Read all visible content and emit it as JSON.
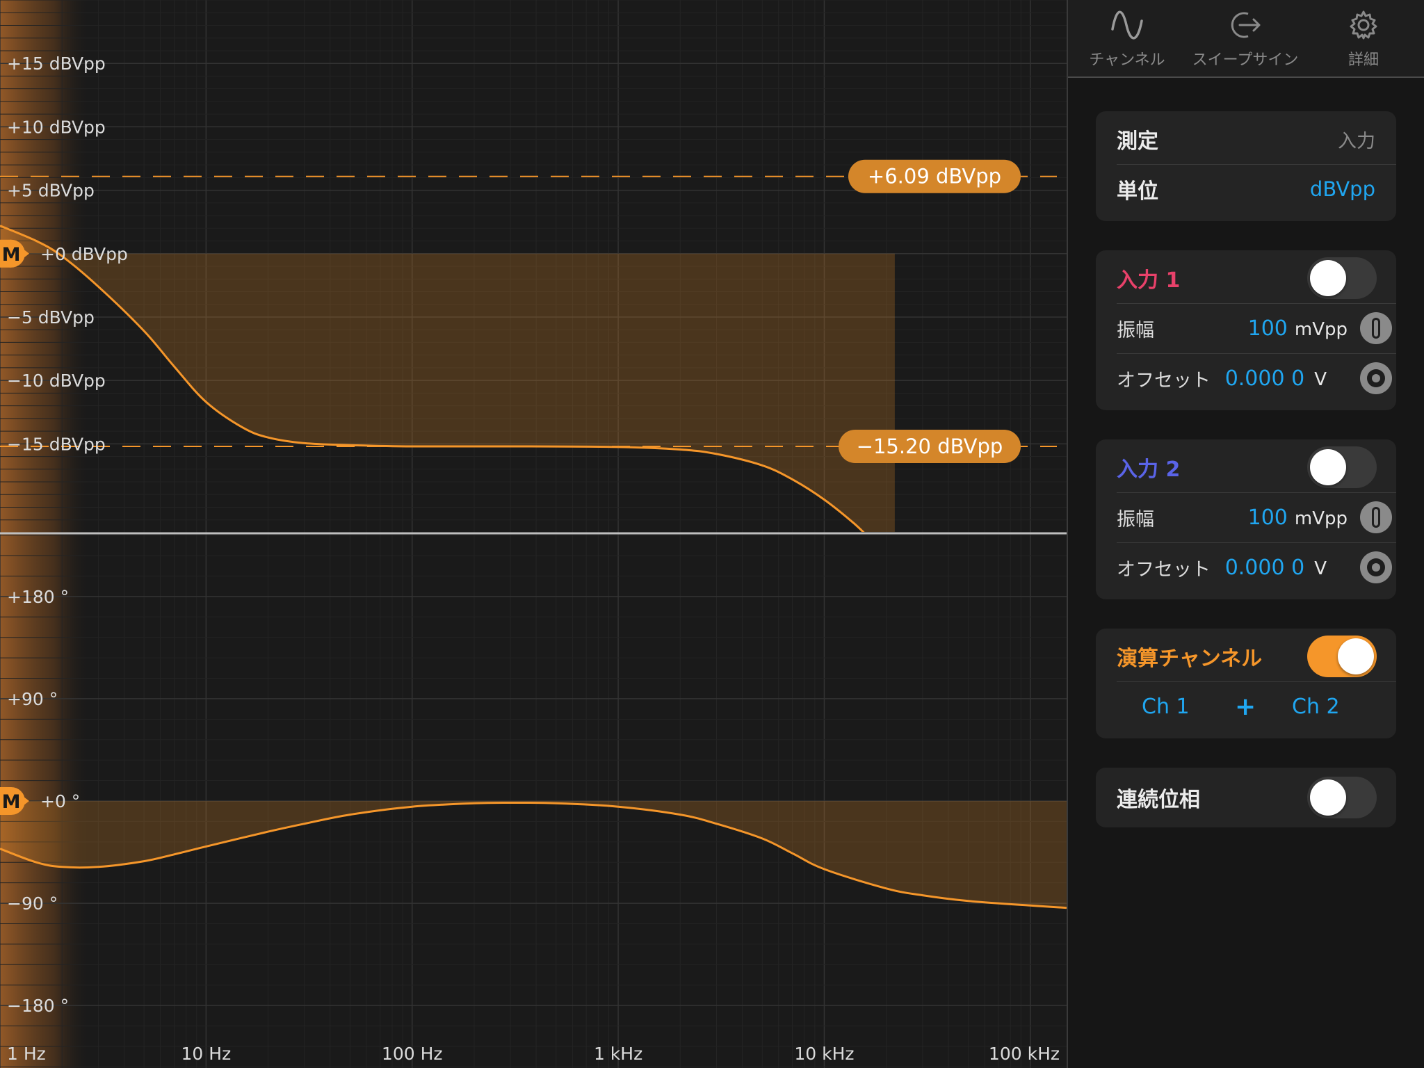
{
  "chart_data": [
    {
      "type": "line",
      "xscale": "log",
      "xlim": [
        1,
        150000
      ],
      "x_ticks": [
        "1 Hz",
        "10 Hz",
        "100 Hz",
        "1 kHz",
        "10 kHz",
        "100 kHz"
      ],
      "x_tick_values": [
        1,
        10,
        100,
        1000,
        10000,
        100000
      ],
      "ylim": [
        -22,
        20
      ],
      "y_ticks": [
        "+15 dBVpp",
        "+10 dBVpp",
        "+5 dBVpp",
        "+0 dBVpp",
        "−5 dBVpp",
        "−10 dBVpp",
        "−15 dBVpp"
      ],
      "y_tick_values": [
        15,
        10,
        5,
        0,
        -5,
        -10,
        -15
      ],
      "grid": true,
      "series": [
        {
          "color": "#f5962a",
          "x": [
            1,
            1.5,
            2,
            3,
            5,
            7,
            10,
            15,
            20,
            30,
            50,
            100,
            300,
            1000,
            2000,
            3000,
            5000,
            7000,
            10000,
            14000,
            18000,
            22000
          ],
          "y": [
            2.2,
            1.0,
            -0.2,
            -2.6,
            -6.1,
            -8.9,
            -11.7,
            -13.7,
            -14.5,
            -14.95,
            -15.1,
            -15.2,
            -15.2,
            -15.25,
            -15.45,
            -15.8,
            -16.7,
            -17.8,
            -19.4,
            -21.3,
            -23.0,
            -24.2
          ]
        }
      ],
      "references": [
        {
          "label": "+6.09 dBVpp",
          "value": 6.09
        },
        {
          "label": "−15.20 dBVpp",
          "value": -15.2
        }
      ],
      "marker": {
        "label": "M",
        "value": 0
      }
    },
    {
      "type": "line",
      "xscale": "log",
      "xlim": [
        1,
        150000
      ],
      "ylim": [
        -235,
        235
      ],
      "y_ticks": [
        "+180 °",
        "+90 °",
        "+0 °",
        "−90 °",
        "−180 °"
      ],
      "y_tick_values": [
        180,
        90,
        0,
        -90,
        -180
      ],
      "grid": true,
      "series": [
        {
          "color": "#f5962a",
          "x": [
            1,
            1.5,
            2,
            3,
            5,
            7,
            10,
            20,
            30,
            50,
            100,
            200,
            300,
            500,
            1000,
            2000,
            3000,
            5000,
            7000,
            10000,
            20000,
            30000,
            50000,
            100000,
            150000
          ],
          "y": [
            -42,
            -54,
            -58,
            -58,
            -53,
            -47,
            -40,
            -27,
            -20,
            -12,
            -5,
            -2,
            -1.5,
            -2,
            -5,
            -12,
            -20,
            -33,
            -46,
            -60,
            -77,
            -83,
            -88,
            -92,
            -94
          ]
        }
      ],
      "marker": {
        "label": "M",
        "value": 0
      }
    }
  ],
  "tabs": [
    {
      "label": "チャンネル",
      "icon": "sine-wave-icon"
    },
    {
      "label": "スイープサイン",
      "icon": "sweep-export-icon"
    },
    {
      "label": "詳細",
      "icon": "gear-icon"
    }
  ],
  "measure": {
    "measure_label": "測定",
    "measure_value": "入力",
    "unit_label": "単位",
    "unit_value": "dBVpp"
  },
  "input1": {
    "title": "入力 1",
    "title_color": "#e8416a",
    "enabled": false,
    "amp_label": "振幅",
    "amp_value": "100",
    "amp_unit": "mVpp",
    "offset_label": "オフセット",
    "offset_value": "0.000 0",
    "offset_unit": "V"
  },
  "input2": {
    "title": "入力 2",
    "title_color": "#5a64e8",
    "enabled": false,
    "amp_label": "振幅",
    "amp_value": "100",
    "amp_unit": "mVpp",
    "offset_label": "オフセット",
    "offset_value": "0.000 0",
    "offset_unit": "V"
  },
  "math": {
    "title": "演算チャンネル",
    "title_color": "#f5962a",
    "enabled": true,
    "operand1": "Ch 1",
    "operator": "+",
    "operand2": "Ch 2"
  },
  "phase": {
    "label": "連続位相",
    "enabled": false
  }
}
